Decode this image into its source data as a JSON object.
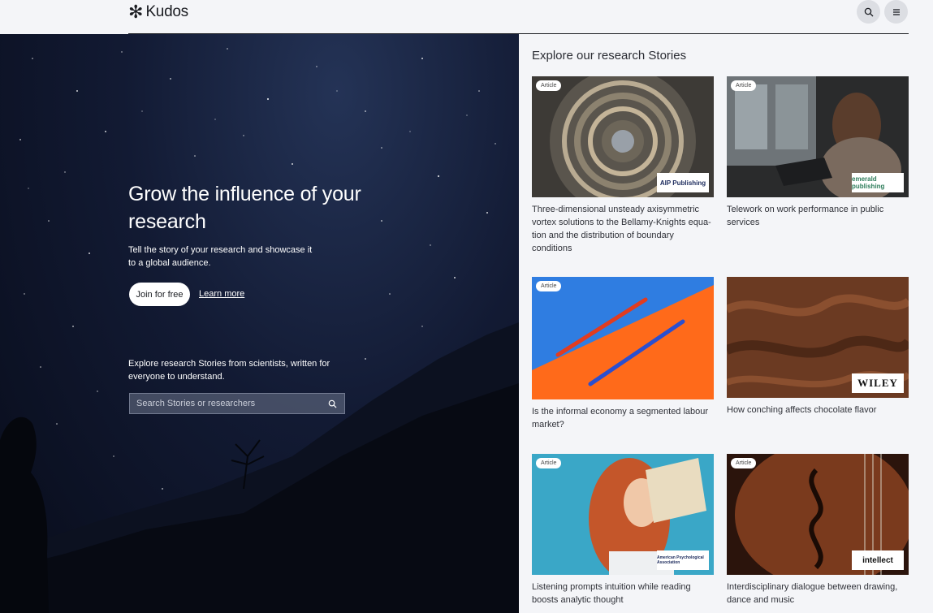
{
  "header": {
    "logo_mark": "✻",
    "logo_text": "Kudos",
    "search_icon": "search-icon",
    "menu_icon": "menu-icon"
  },
  "hero": {
    "title": "Grow the influence of your research",
    "subtitle": "Tell the story of your research and showcase it to a global audience.",
    "join_label": "Join for free",
    "learn_label": "Learn more",
    "explore_text": "Explore research Stories from scientists, written for everyone to understand.",
    "search_placeholder": "Search Stories or researchers"
  },
  "stories": {
    "title": "Explore our research Stories",
    "items": [
      {
        "badge": "Article",
        "caption": "Three-dimensional unsteady axisymmetric vortex solutions to the Bellamy-Knights equa-tion and the distribution of boundary conditions",
        "publisher": "AIP Publishing"
      },
      {
        "badge": "Article",
        "caption": "Telework on work performance in public services",
        "publisher": "emerald publishing"
      },
      {
        "badge": "Article",
        "caption": "Is the informal economy a segmented labour market?",
        "publisher": ""
      },
      {
        "badge": "",
        "caption": "How conching affects chocolate flavor",
        "publisher": "WILEY"
      },
      {
        "badge": "Article",
        "caption": "Listening prompts intuition while reading boosts analytic thought",
        "publisher": "American Psychological Association"
      },
      {
        "badge": "Article",
        "caption": "Interdisciplinary dialogue between drawing, dance and music",
        "publisher": "intellect"
      }
    ]
  },
  "colors": {
    "page_bg": "#f4f5f8",
    "hero_bg": "#121a33",
    "text_dark": "#1b1d22"
  }
}
